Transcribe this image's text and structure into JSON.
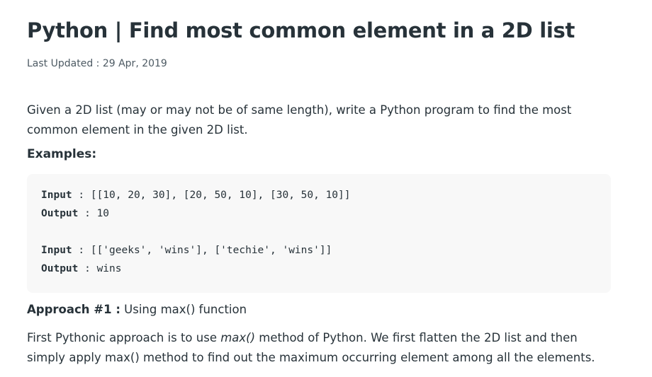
{
  "article": {
    "title": "Python | Find most common element in a 2D list",
    "updated_label": "Last Updated : ",
    "updated_date": "29 Apr, 2019",
    "intro": "Given a 2D list (may or may not be of same length), write a Python program to find the most common element in the given 2D list.",
    "examples_heading": "Examples:",
    "examples": [
      {
        "input_label": "Input",
        "input_value": " : [[10, 20, 30], [20, 50, 10], [30, 50, 10]]",
        "output_label": "Output",
        "output_value": " : 10"
      },
      {
        "input_label": "Input",
        "input_value": " : [['geeks', 'wins'], ['techie', 'wins']]",
        "output_label": "Output",
        "output_value": " : wins"
      }
    ],
    "approach": {
      "label": "Approach #1 :",
      "text": " Using max() function"
    },
    "approach_desc": {
      "before": "First Pythonic approach is to use ",
      "emphasis": "max()",
      "after": " method of Python. We first flatten the 2D list and then simply apply max() method to find out the maximum occurring element among all the elements."
    }
  }
}
